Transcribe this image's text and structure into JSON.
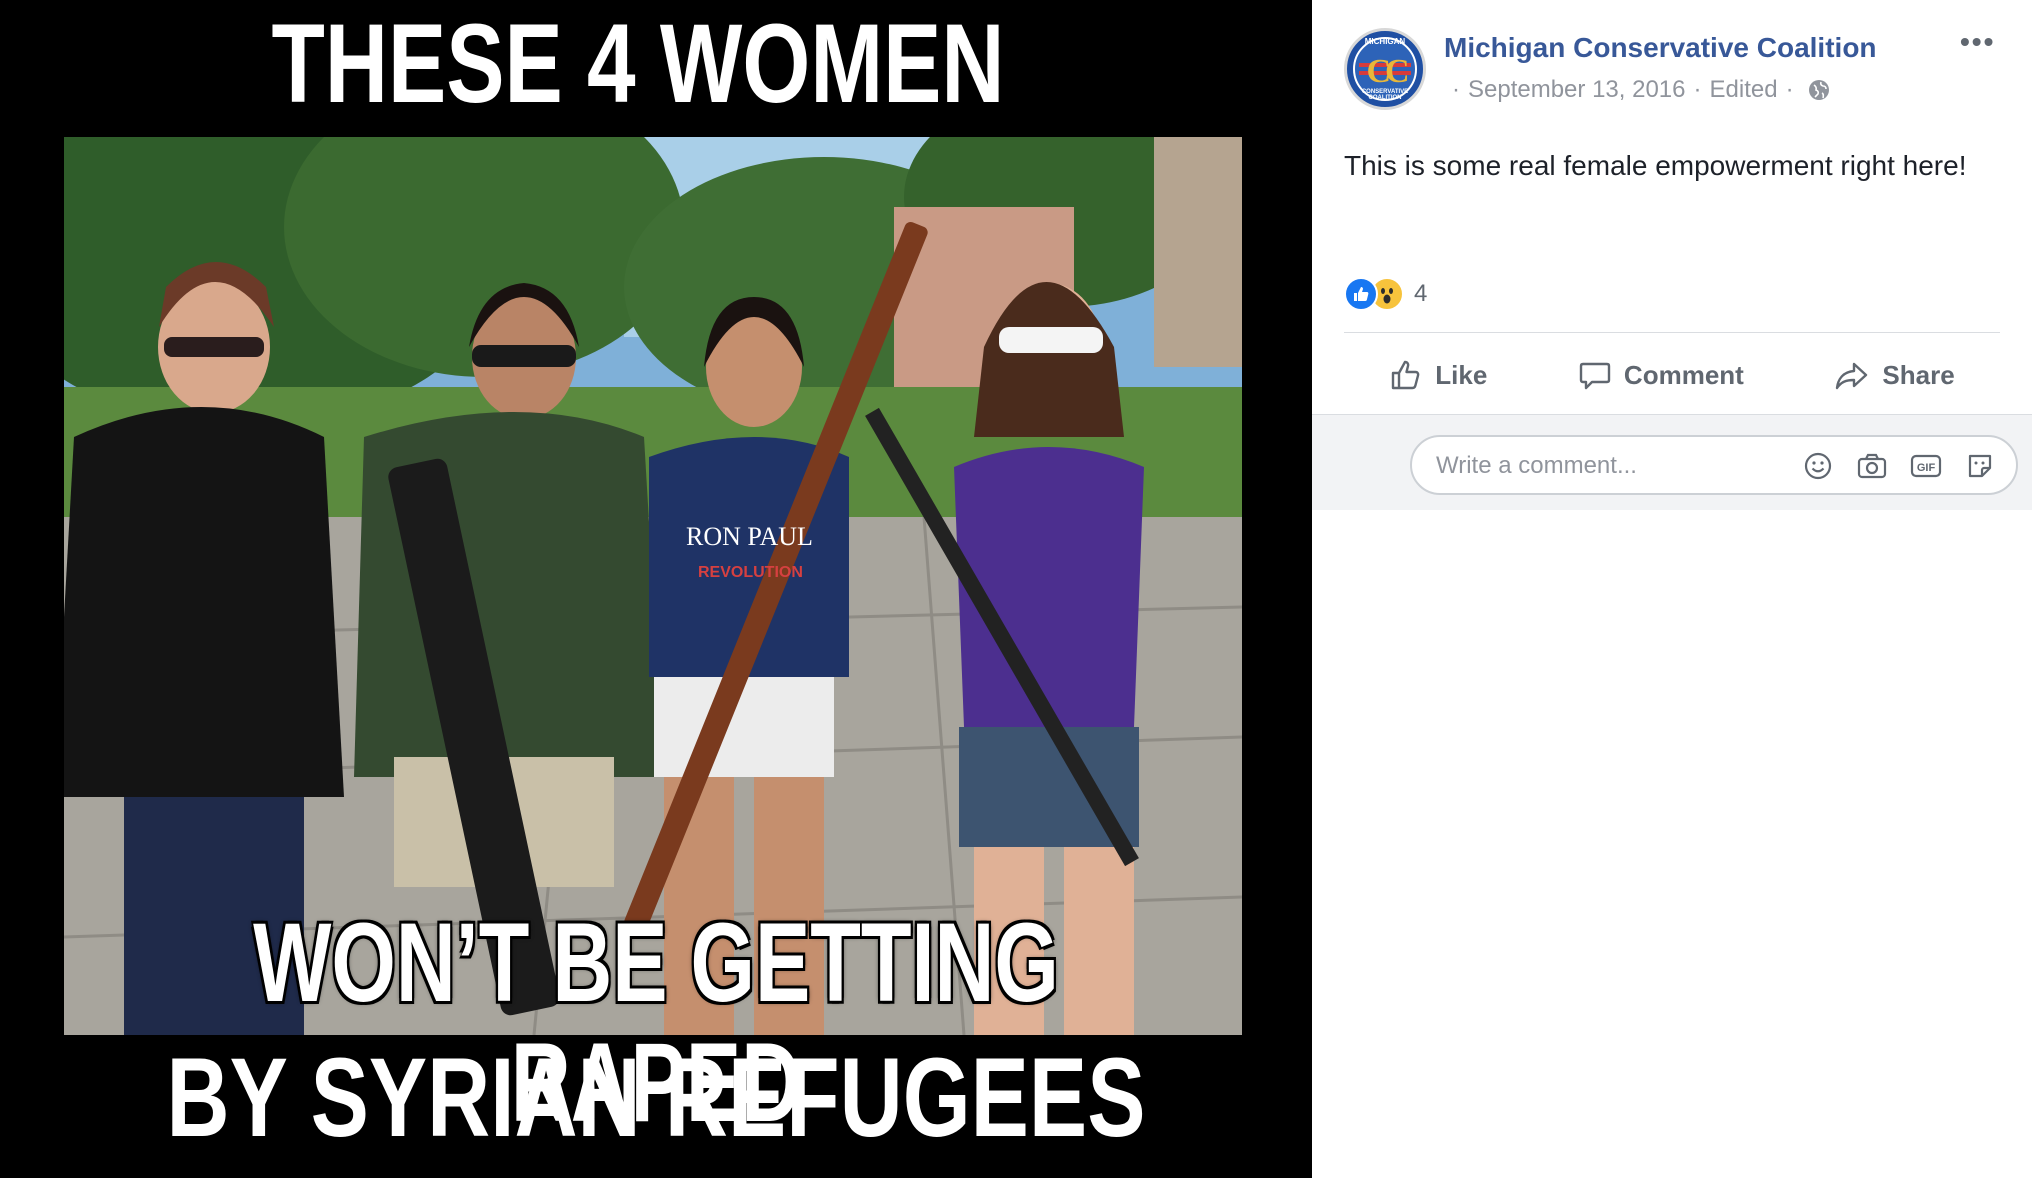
{
  "meme": {
    "top_text": "THESE 4 WOMEN",
    "bottom_text_line1": "WON’T BE GETTING RAPED",
    "bottom_text_line2": "BY SYRIAN REFUGEES",
    "shirt_text": "RON PAUL",
    "shirt_subtext": "REVOLUTION"
  },
  "post": {
    "page_name": "Michigan Conservative Coalition",
    "logo_top_text": "MICHIGAN",
    "logo_letters": "CC",
    "logo_bottom_text": "CONSERVATIVE COALITION",
    "date": "September 13, 2016",
    "edited": "Edited",
    "privacy_icon": "globe-icon",
    "text": "This is some real female empowerment right here!",
    "reaction_count": "4",
    "reactions": [
      "like",
      "wow"
    ]
  },
  "actions": {
    "like": "Like",
    "comment": "Comment",
    "share": "Share"
  },
  "comment": {
    "placeholder": "Write a comment...",
    "icons": [
      "emoji-icon",
      "camera-icon",
      "gif-icon",
      "sticker-icon"
    ],
    "gif_label": "GIF"
  },
  "colors": {
    "page_name": "#385898",
    "meta": "#90949c",
    "like_blue": "#1877f2",
    "wow_yellow": "#f7c33c",
    "action_gray": "#606770"
  }
}
